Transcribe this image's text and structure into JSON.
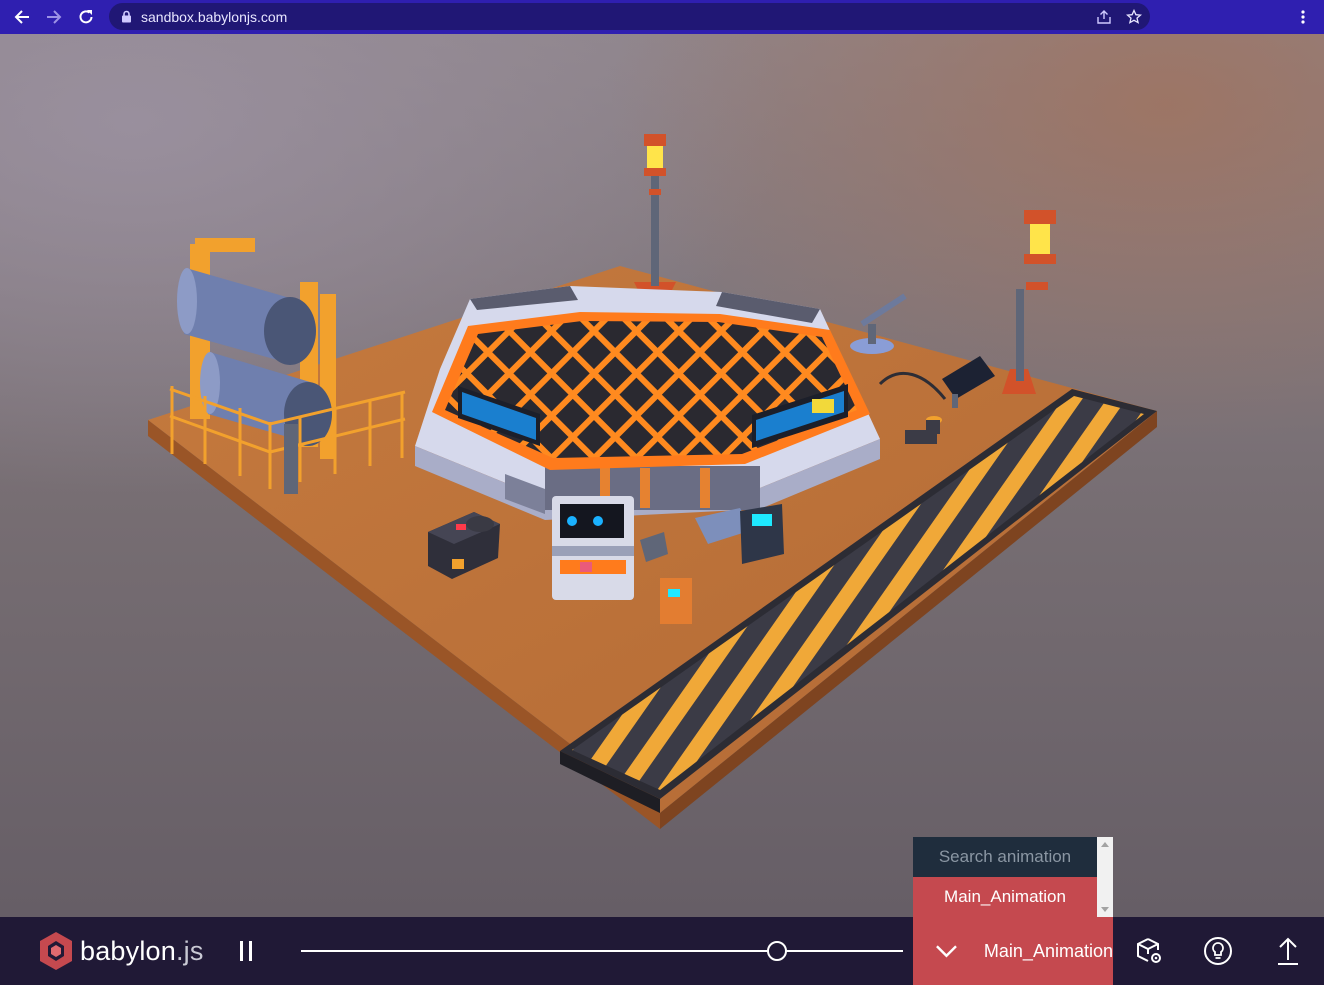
{
  "browser": {
    "url": "sandbox.babylonjs.com"
  },
  "animation_panel": {
    "search_placeholder": "Search animation",
    "items": [
      "Main_Animation"
    ]
  },
  "footer": {
    "brand": "babylon",
    "brand_suffix": ".js",
    "selected_animation": "Main_Animation",
    "timeline_progress": 0.79
  },
  "colors": {
    "browser_bar": "#2f1fb0",
    "footer_bg": "#201936",
    "accent": "#c5494f",
    "search_bg": "#1f2d3d"
  },
  "icons": {
    "back": "arrow-left-icon",
    "forward": "arrow-right-icon",
    "reload": "reload-icon",
    "lock": "lock-icon",
    "share": "share-icon",
    "bookmark": "star-icon",
    "menu": "kebab-menu-icon",
    "pause": "pause-icon",
    "dropdown": "chevron-down-icon",
    "inspector": "cube-gear-icon",
    "hint": "lightbulb-icon",
    "upload": "upload-icon"
  }
}
